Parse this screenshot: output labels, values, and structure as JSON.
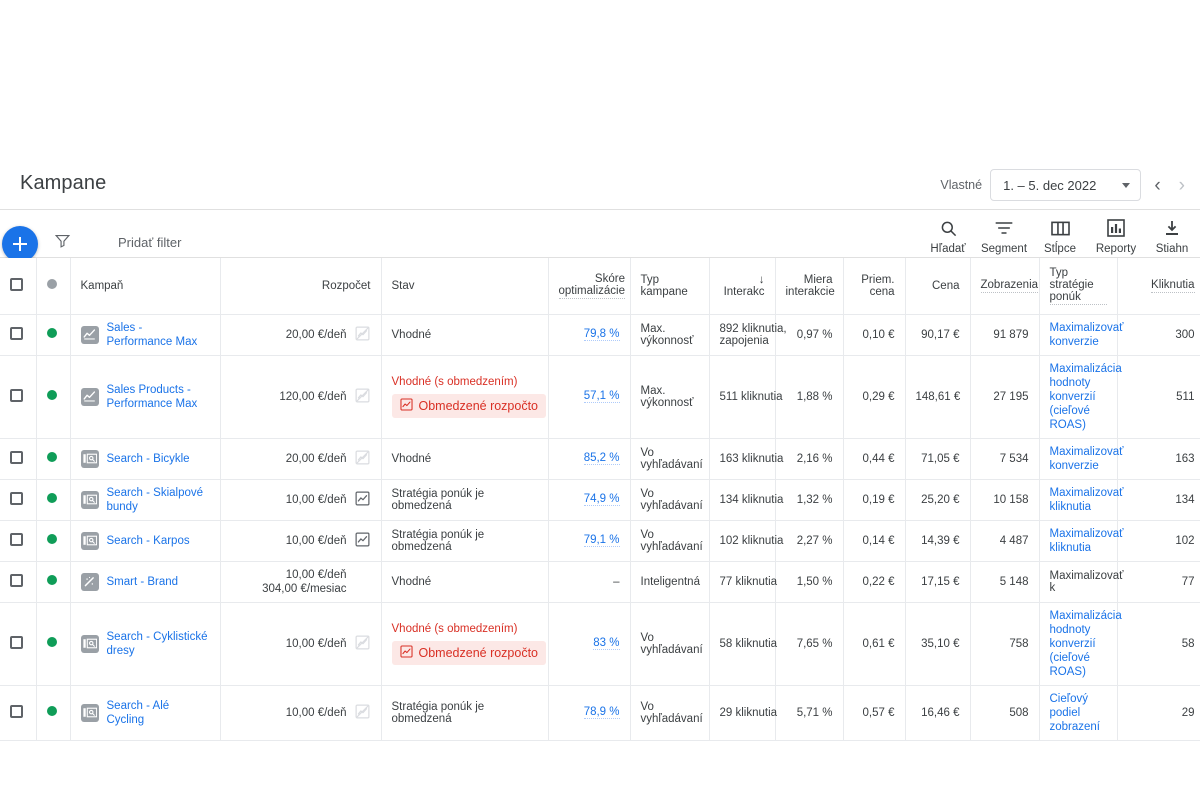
{
  "header": {
    "title": "Kampane",
    "daterange_label": "Vlastné",
    "daterange_value": "1. – 5. dec 2022",
    "prev_arrow": "‹",
    "next_arrow": "›"
  },
  "toolbar": {
    "filter_placeholder": "Pridať filter",
    "add_label": "+",
    "actions": [
      {
        "label": "Hľadať",
        "icon": "search-icon"
      },
      {
        "label": "Segment",
        "icon": "segment-icon"
      },
      {
        "label": "Stĺpce",
        "icon": "columns-icon"
      },
      {
        "label": "Reporty",
        "icon": "reports-icon"
      },
      {
        "label": "Stiahn",
        "icon": "download-icon"
      }
    ]
  },
  "table": {
    "columns": [
      {
        "key": "checkbox",
        "label": "",
        "align": "left"
      },
      {
        "key": "status",
        "label": "",
        "align": "left"
      },
      {
        "key": "campaign",
        "label": "Kampaň",
        "align": "left"
      },
      {
        "key": "budget",
        "label": "Rozpočet",
        "align": "right"
      },
      {
        "key": "state",
        "label": "Stav",
        "align": "left"
      },
      {
        "key": "score",
        "label": "Skóre optimalizácie",
        "align": "right"
      },
      {
        "key": "type",
        "label": "Typ kampane",
        "align": "left"
      },
      {
        "key": "interactions",
        "label": "Interakc",
        "align": "right",
        "sort": "↓"
      },
      {
        "key": "rate",
        "label": "Miera interakcie",
        "align": "right"
      },
      {
        "key": "avgcost",
        "label": "Priem. cena",
        "align": "right"
      },
      {
        "key": "cost",
        "label": "Cena",
        "align": "right"
      },
      {
        "key": "impressions",
        "label": "Zobrazenia",
        "align": "right"
      },
      {
        "key": "bidstrategy",
        "label": "Typ stratégie ponúk",
        "align": "left"
      },
      {
        "key": "clicks",
        "label": "Kliknutia",
        "align": "right"
      }
    ],
    "rows": [
      {
        "status_color": "#0f9d58",
        "campaign": "Sales - Performance Max",
        "type_icon": "performance-max-icon",
        "budget": "20,00 €/deň",
        "budget_chart_enabled": false,
        "state": "Vhodné",
        "state_warning": "",
        "chip": "",
        "score": "79,8 %",
        "camp_type": "Max. výkonnosť",
        "interactions": "892 kliknutia, zapojenia",
        "rate": "0,97 %",
        "avgcost": "0,10 €",
        "cost": "90,17 €",
        "impressions": "91 879",
        "bidstrategy": "Maximalizovať konverzie",
        "bid_is_link": true,
        "clicks": "300"
      },
      {
        "status_color": "#0f9d58",
        "campaign": "Sales Products - Performance Max",
        "type_icon": "performance-max-icon",
        "budget": "120,00 €/deň",
        "budget_chart_enabled": false,
        "state": "",
        "state_warning": "Vhodné (s obmedzením)",
        "chip": "Obmedzené rozpočto",
        "score": "57,1 %",
        "camp_type": "Max. výkonnosť",
        "interactions": "511 kliknutia",
        "rate": "1,88 %",
        "avgcost": "0,29 €",
        "cost": "148,61 €",
        "impressions": "27 195",
        "bidstrategy": "Maximalizácia hodnoty konverzií (cieľové ROAS)",
        "bid_is_link": true,
        "clicks": "511"
      },
      {
        "status_color": "#0f9d58",
        "campaign": "Search - Bicykle",
        "type_icon": "search-campaign-icon",
        "budget": "20,00 €/deň",
        "budget_chart_enabled": false,
        "state": "Vhodné",
        "state_warning": "",
        "chip": "",
        "score": "85,2 %",
        "camp_type": "Vo vyhľadávaní",
        "interactions": "163 kliknutia",
        "rate": "2,16 %",
        "avgcost": "0,44 €",
        "cost": "71,05 €",
        "impressions": "7 534",
        "bidstrategy": "Maximalizovať konverzie",
        "bid_is_link": true,
        "clicks": "163"
      },
      {
        "status_color": "#0f9d58",
        "campaign": "Search - Skialpové bundy",
        "type_icon": "search-campaign-icon",
        "budget": "10,00 €/deň",
        "budget_chart_enabled": true,
        "state": "Stratégia ponúk je obmedzená",
        "state_warning": "",
        "chip": "",
        "score": "74,9 %",
        "camp_type": "Vo vyhľadávaní",
        "interactions": "134 kliknutia",
        "rate": "1,32 %",
        "avgcost": "0,19 €",
        "cost": "25,20 €",
        "impressions": "10 158",
        "bidstrategy": "Maximalizovať kliknutia",
        "bid_is_link": true,
        "clicks": "134"
      },
      {
        "status_color": "#0f9d58",
        "campaign": "Search - Karpos",
        "type_icon": "search-campaign-icon",
        "budget": "10,00 €/deň",
        "budget_chart_enabled": true,
        "state": "Stratégia ponúk je obmedzená",
        "state_warning": "",
        "chip": "",
        "score": "79,1 %",
        "camp_type": "Vo vyhľadávaní",
        "interactions": "102 kliknutia",
        "rate": "2,27 %",
        "avgcost": "0,14 €",
        "cost": "14,39 €",
        "impressions": "4 487",
        "bidstrategy": "Maximalizovať kliknutia",
        "bid_is_link": true,
        "clicks": "102"
      },
      {
        "status_color": "#0f9d58",
        "campaign": "Smart - Brand",
        "type_icon": "smart-campaign-icon",
        "budget": "10,00 €/deň\n304,00 €/mesiac",
        "budget_chart_enabled": null,
        "state": "Vhodné",
        "state_warning": "",
        "chip": "",
        "score": "–",
        "camp_type": "Inteligentná",
        "interactions": "77 kliknutia",
        "rate": "1,50 %",
        "avgcost": "0,22 €",
        "cost": "17,15 €",
        "impressions": "5 148",
        "bidstrategy": "Maximalizovať k",
        "bid_is_link": false,
        "clicks": "77"
      },
      {
        "status_color": "#0f9d58",
        "campaign": "Search - Cyklistické dresy",
        "type_icon": "search-campaign-icon",
        "budget": "10,00 €/deň",
        "budget_chart_enabled": false,
        "state": "",
        "state_warning": "Vhodné (s obmedzením)",
        "chip": "Obmedzené rozpočto",
        "score": "83 %",
        "camp_type": "Vo vyhľadávaní",
        "interactions": "58 kliknutia",
        "rate": "7,65 %",
        "avgcost": "0,61 €",
        "cost": "35,10 €",
        "impressions": "758",
        "bidstrategy": "Maximalizácia hodnoty konverzií (cieľové ROAS)",
        "bid_is_link": true,
        "clicks": "58"
      },
      {
        "status_color": "#0f9d58",
        "campaign": "Search - Alé Cycling",
        "type_icon": "search-campaign-icon",
        "budget": "10,00 €/deň",
        "budget_chart_enabled": false,
        "state": "Stratégia ponúk je obmedzená",
        "state_warning": "",
        "chip": "",
        "score": "78,9 %",
        "camp_type": "Vo vyhľadávaní",
        "interactions": "29 kliknutia",
        "rate": "5,71 %",
        "avgcost": "0,57 €",
        "cost": "16,46 €",
        "impressions": "508",
        "bidstrategy": "Cieľový podiel zobrazení",
        "bid_is_link": true,
        "clicks": "29"
      }
    ]
  },
  "colors": {
    "accent": "#1a73e8",
    "enabled_status": "#0f9d58",
    "warning": "#d93025",
    "chip_bg": "#fce8e6"
  }
}
